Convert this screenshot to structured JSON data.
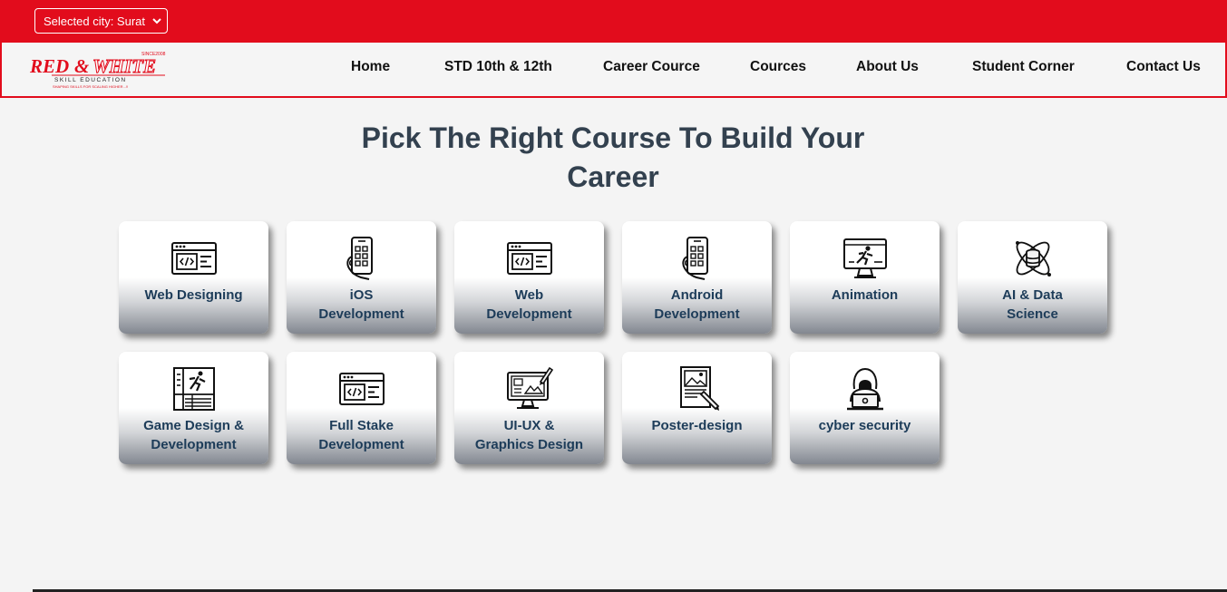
{
  "city_select": {
    "label": "Selected city: Surat"
  },
  "logo": {
    "brand_red": "RED",
    "brand_amp": "&",
    "brand_white": "WHITE",
    "since": "SINCE2008",
    "subtitle": "SKILL EDUCATION",
    "tagline": "SHAPING SKILLS FOR SCALING HIGHER...!!"
  },
  "nav": {
    "items": [
      "Home",
      "STD 10th & 12th",
      "Career Cource",
      "Cources",
      "About Us",
      "Student Corner",
      "Contact Us"
    ]
  },
  "main": {
    "headline_line1": "Pick The Right Course To Build Your",
    "headline_line2": "Career"
  },
  "courses": [
    {
      "line1": "Web Designing",
      "line2": "",
      "icon": "code-window-icon"
    },
    {
      "line1": "iOS",
      "line2": "Development",
      "icon": "smartphone-app-icon"
    },
    {
      "line1": "Web",
      "line2": "Development",
      "icon": "code-window-icon"
    },
    {
      "line1": "Android",
      "line2": "Development",
      "icon": "smartphone-app-icon"
    },
    {
      "line1": "Animation",
      "line2": "",
      "icon": "animation-monitor-icon"
    },
    {
      "line1": "AI & Data",
      "line2": "Science",
      "icon": "data-atom-icon"
    },
    {
      "line1": "Game Design &",
      "line2": "Development",
      "icon": "game-frame-icon"
    },
    {
      "line1": "Full Stake",
      "line2": "Development",
      "icon": "code-window-icon"
    },
    {
      "line1": "UI-UX &",
      "line2": "Graphics Design",
      "icon": "design-monitor-icon"
    },
    {
      "line1": "Poster-design",
      "line2": "",
      "icon": "poster-pen-icon"
    },
    {
      "line1": "cyber security",
      "line2": "",
      "icon": "hacker-laptop-icon"
    }
  ],
  "colors": {
    "brand_red": "#e20c1c",
    "heading": "#33414f",
    "card_text": "#1d3c59"
  }
}
